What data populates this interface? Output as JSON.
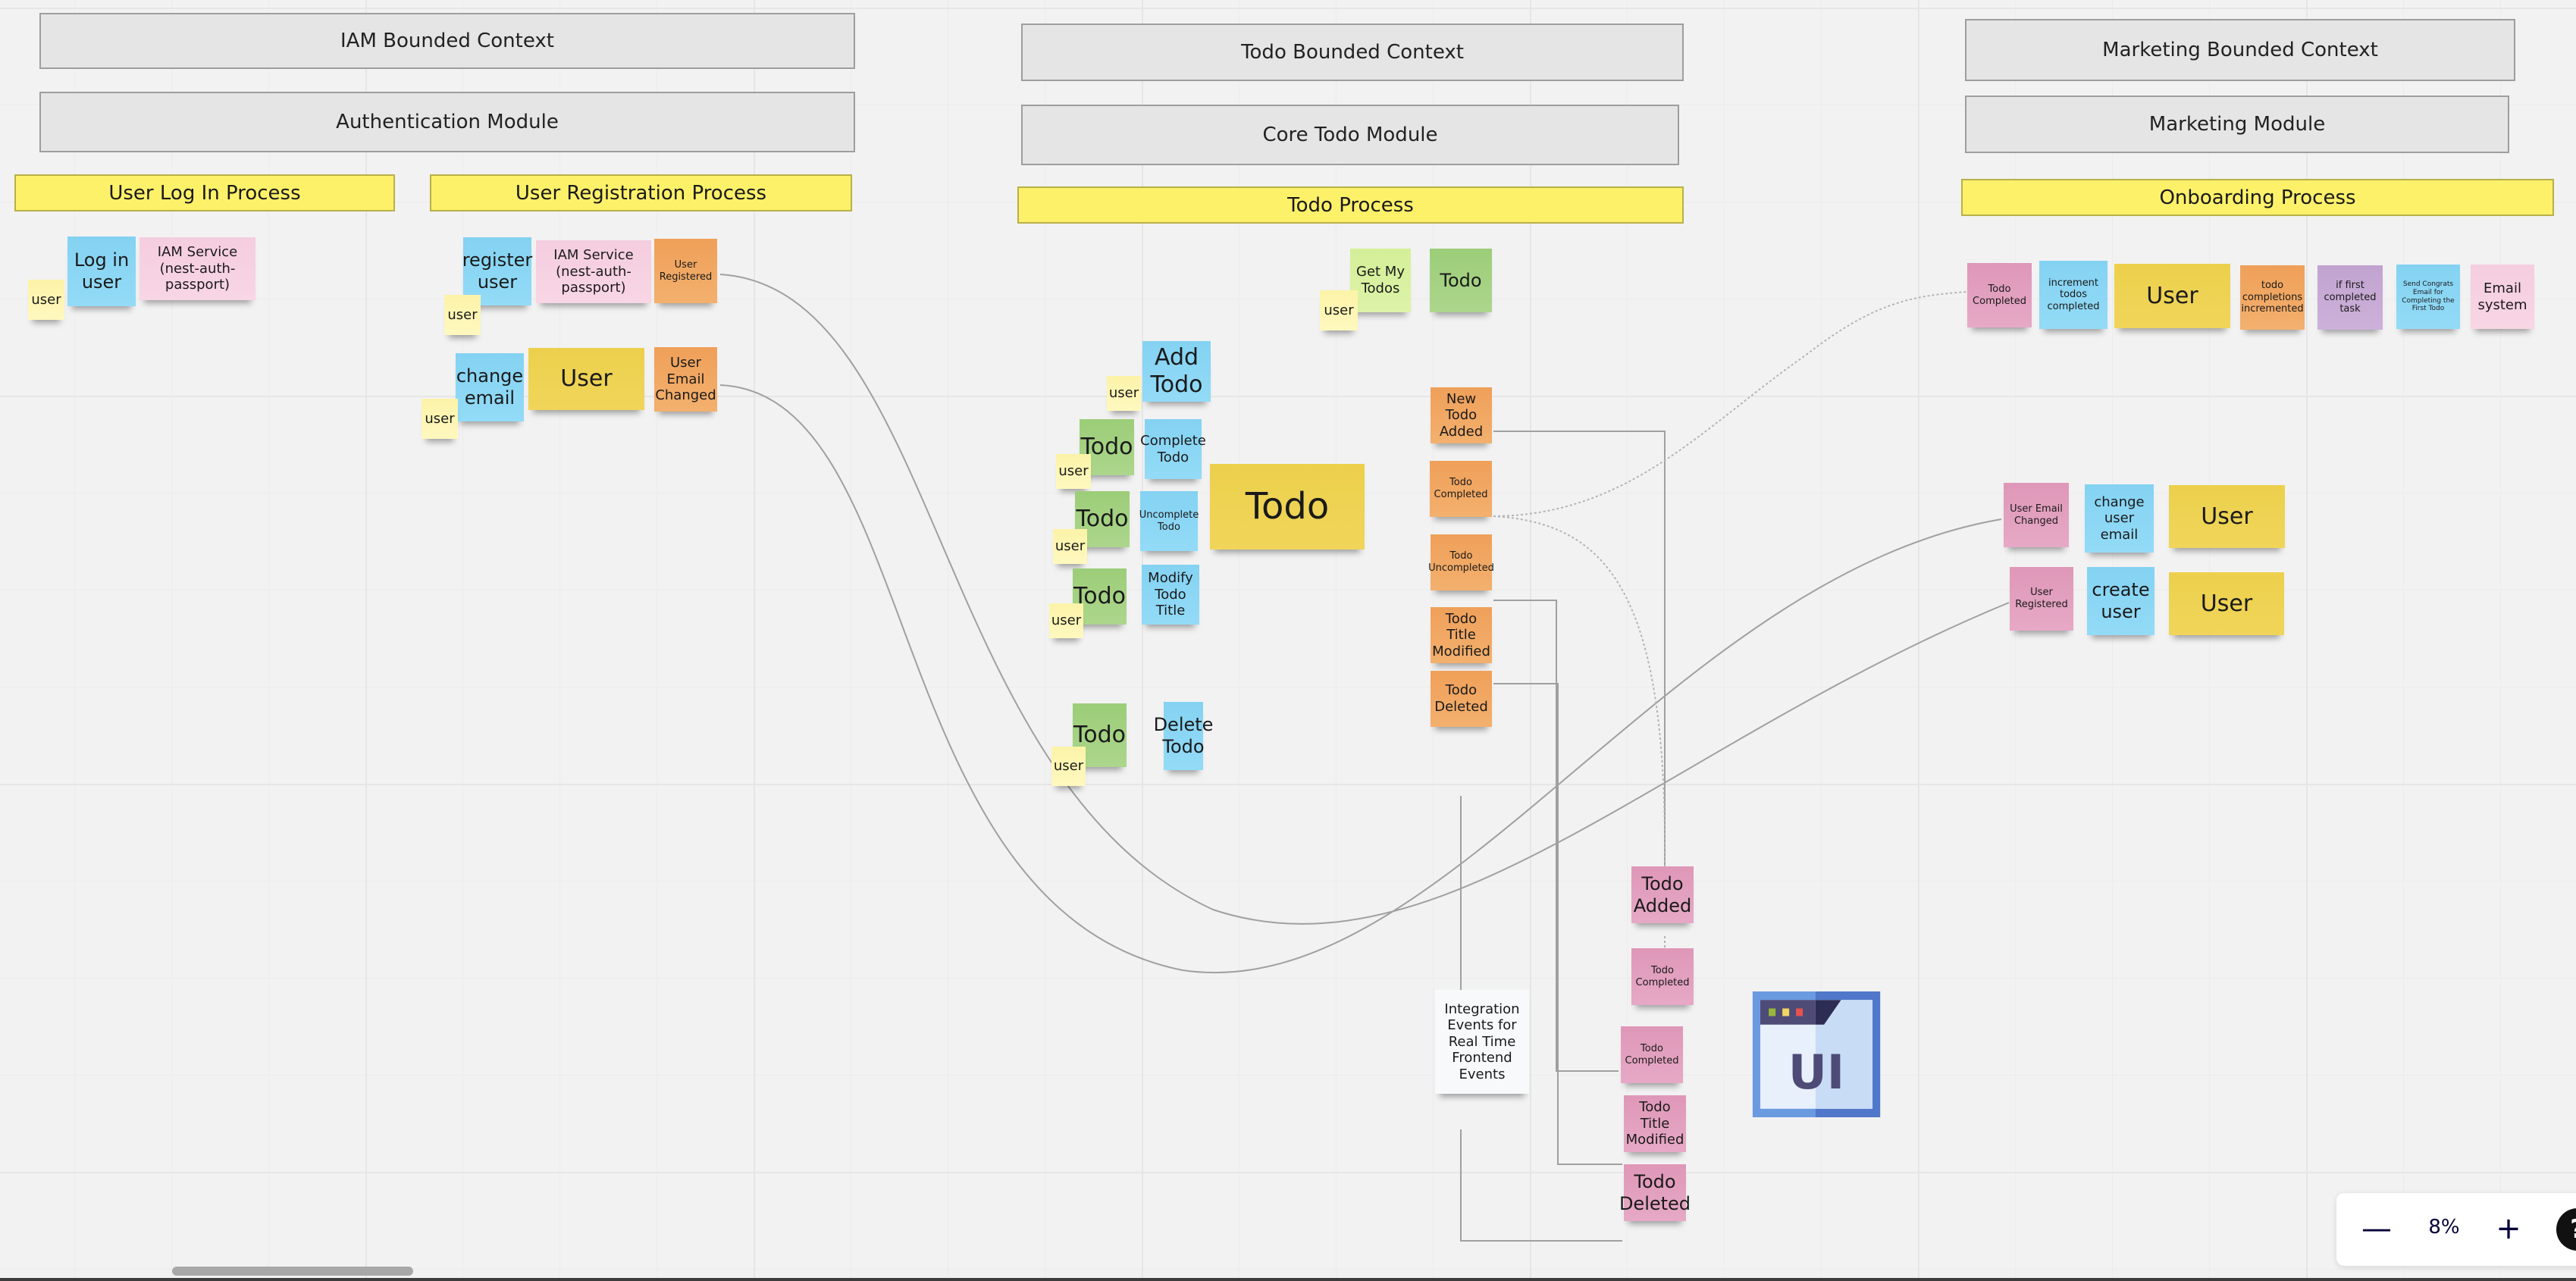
{
  "board": {
    "zoom_level": "8%",
    "contexts": [
      {
        "title": "IAM Bounded Context",
        "module": "Authentication Module"
      },
      {
        "title": "Todo Bounded Context",
        "module": "Core Todo Module"
      },
      {
        "title": "Marketing Bounded Context",
        "module": "Marketing Module"
      }
    ],
    "processes": {
      "login": "User Log In Process",
      "registration": "User Registration Process",
      "todo": "Todo Process",
      "onboarding": "Onboarding Process"
    },
    "iam": {
      "login": {
        "actor": "user",
        "command": "Log in user",
        "system": "IAM Service (nest-auth-passport)"
      },
      "register": {
        "actor": "user",
        "command": "register user",
        "system": "IAM Service (nest-auth-passport)",
        "event": "User Registered"
      },
      "change_email": {
        "actor": "user",
        "command": "change email",
        "aggregate": "User",
        "event": "User Email Changed"
      }
    },
    "todo": {
      "get_my_todos": {
        "actor": "user",
        "query": "Get My Todos",
        "read_model": "Todo"
      },
      "add": {
        "actor": "user",
        "command": "Add Todo"
      },
      "rows": [
        {
          "actor": "user",
          "read_model": "Todo",
          "command": "Complete Todo"
        },
        {
          "actor": "user",
          "read_model": "Todo",
          "command": "Uncomplete Todo"
        },
        {
          "actor": "user",
          "read_model": "Todo",
          "command": "Modify Todo Title"
        },
        {
          "actor": "user",
          "read_model": "Todo",
          "command": "Delete Todo"
        }
      ],
      "aggregate": "Todo",
      "events": [
        "New Todo Added",
        "Todo Completed",
        "Todo Uncompleted",
        "Todo Title Modified",
        "Todo Deleted"
      ]
    },
    "integration": {
      "note": "Integration Events for Real Time Frontend Events",
      "events": [
        "Todo Added",
        "Todo Completed",
        "Todo Completed",
        "Todo Title Modified",
        "Todo Deleted"
      ],
      "ui_icon_label": "UI"
    },
    "marketing": {
      "onboarding_row": [
        "Todo Completed",
        "increment todos completed",
        "User",
        "todo completions incremented",
        "if first completed task",
        "Send Congrats Email for Completing the First Todo",
        "Email system"
      ],
      "email_changed": {
        "event": "User Email Changed",
        "command": "change user email",
        "aggregate": "User"
      },
      "registered": {
        "event": "User Registered",
        "command": "create user",
        "aggregate": "User"
      }
    },
    "colors": {
      "command": "#8dd6f4",
      "domain_event": "#f1a660",
      "aggregate": "#eed350",
      "actor": "#fdf5b0",
      "read_model": "#a3d17f",
      "integration_event": "#e29fbf",
      "external_system": "#f7d2e2",
      "policy": "#c7aad5",
      "process": "#fdf16a"
    }
  }
}
